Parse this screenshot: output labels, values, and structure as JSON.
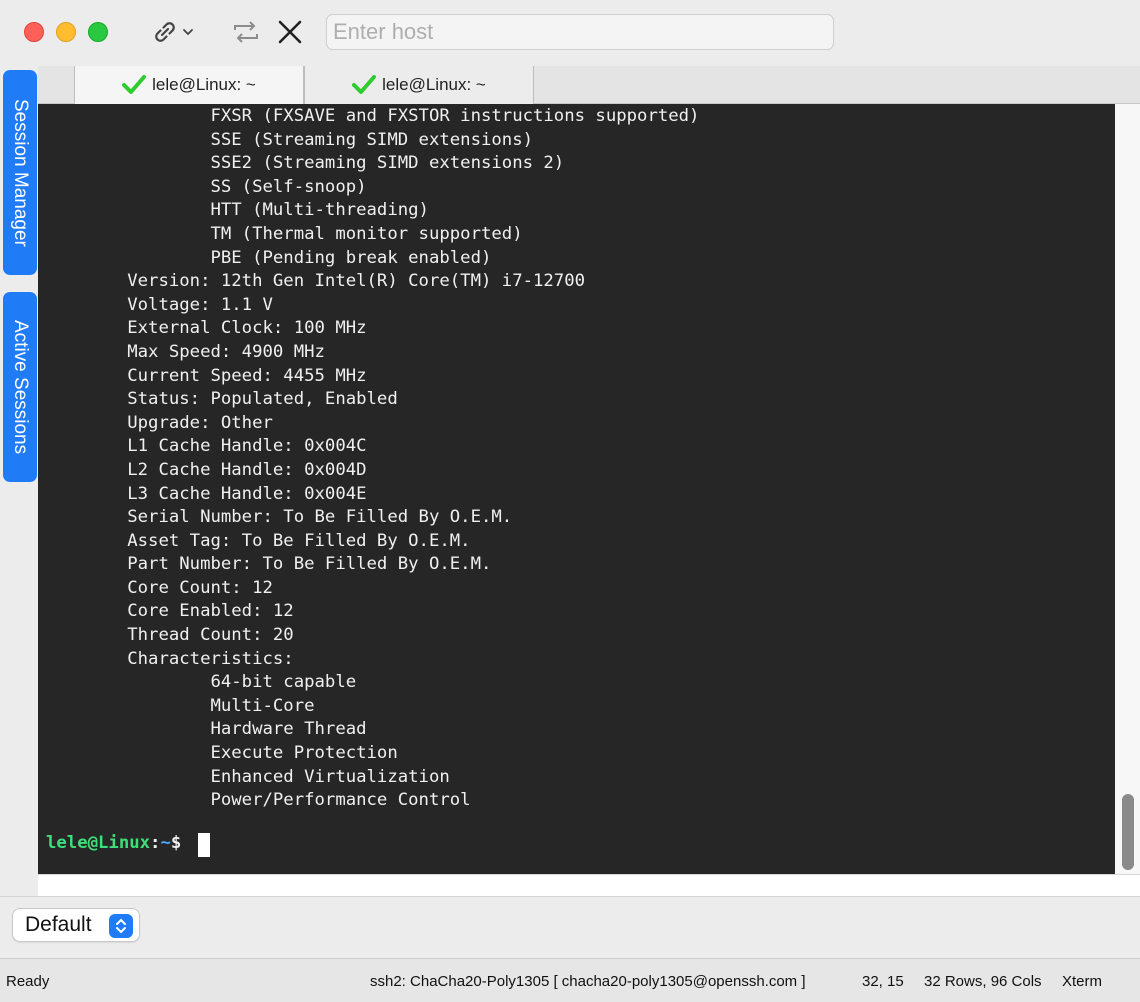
{
  "toolbar": {
    "host_placeholder": "Enter host",
    "host_value": ""
  },
  "side_tabs": {
    "session_manager": "Session Manager",
    "active_sessions": "Active Sessions"
  },
  "tabs": [
    {
      "label": "lele@Linux: ~",
      "status_icon": "check-icon",
      "active": true
    },
    {
      "label": "lele@Linux: ~",
      "status_icon": "check-icon",
      "active": false
    }
  ],
  "terminal": {
    "lines": [
      "\t\tFXSR (FXSAVE and FXSTOR instructions supported)",
      "\t\tSSE (Streaming SIMD extensions)",
      "\t\tSSE2 (Streaming SIMD extensions 2)",
      "\t\tSS (Self-snoop)",
      "\t\tHTT (Multi-threading)",
      "\t\tTM (Thermal monitor supported)",
      "\t\tPBE (Pending break enabled)",
      "\tVersion: 12th Gen Intel(R) Core(TM) i7-12700",
      "\tVoltage: 1.1 V",
      "\tExternal Clock: 100 MHz",
      "\tMax Speed: 4900 MHz",
      "\tCurrent Speed: 4455 MHz",
      "\tStatus: Populated, Enabled",
      "\tUpgrade: Other",
      "\tL1 Cache Handle: 0x004C",
      "\tL2 Cache Handle: 0x004D",
      "\tL3 Cache Handle: 0x004E",
      "\tSerial Number: To Be Filled By O.E.M.",
      "\tAsset Tag: To Be Filled By O.E.M.",
      "\tPart Number: To Be Filled By O.E.M.",
      "\tCore Count: 12",
      "\tCore Enabled: 12",
      "\tThread Count: 20",
      "\tCharacteristics:",
      "\t\t64-bit capable",
      "\t\tMulti-Core",
      "\t\tHardware Thread",
      "\t\tExecute Protection",
      "\t\tEnhanced Virtualization",
      "\t\tPower/Performance Control",
      ""
    ],
    "prompt_user": "lele@Linux",
    "prompt_sep": ":",
    "prompt_path": "~",
    "prompt_symbol": "$ "
  },
  "profile": {
    "selected": "Default"
  },
  "status": {
    "state": "Ready",
    "cipher": "ssh2: ChaCha20-Poly1305 [ chacha20-poly1305@openssh.com ]",
    "cursor_pos": "32,  15",
    "dims": "32 Rows, 96 Cols",
    "term_type": "Xterm"
  },
  "colors": {
    "accent": "#1f7cf6",
    "terminal_bg": "#262626",
    "prompt_user": "#3ce07a",
    "prompt_path": "#4aa8ff",
    "check": "#2ecc2e"
  }
}
